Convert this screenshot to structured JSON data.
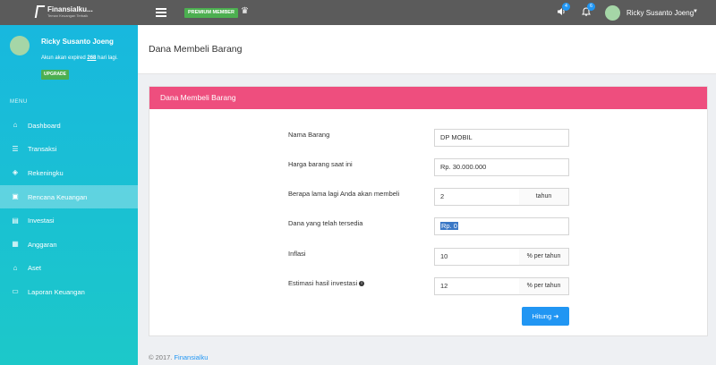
{
  "topbar": {
    "logo_text": "Finansialku...",
    "logo_sub": "Teman Keuangan Terbaik",
    "premium_label": "PREMIUM MEMBER",
    "sound_badge": "4",
    "bell_badge": "6",
    "user_name": "Ricky Susanto Joeng"
  },
  "sidebar": {
    "user_name": "Ricky Susanto Joeng",
    "expire_prefix": "Akun akan expired ",
    "expire_days": "268",
    "expire_suffix": " hari lagi.",
    "upgrade_label": "UPGRADE",
    "menu_heading": "MENU",
    "items": [
      {
        "label": "Dashboard",
        "icon": "home-icon"
      },
      {
        "label": "Transaksi",
        "icon": "list-icon"
      },
      {
        "label": "Rekeningku",
        "icon": "layers-icon"
      },
      {
        "label": "Rencana Keuangan",
        "icon": "clipboard-icon"
      },
      {
        "label": "Investasi",
        "icon": "chart-icon"
      },
      {
        "label": "Anggaran",
        "icon": "table-icon"
      },
      {
        "label": "Aset",
        "icon": "building-icon"
      },
      {
        "label": "Laporan Keuangan",
        "icon": "folder-icon"
      }
    ],
    "active_index": 3
  },
  "main": {
    "page_title": "Dana Membeli Barang",
    "card_title": "Dana Membeli Barang",
    "fields": {
      "nama_barang": {
        "label": "Nama Barang",
        "value": "DP MOBIL"
      },
      "harga": {
        "label": "Harga barang saat ini",
        "value": "Rp. 30.000.000"
      },
      "lama": {
        "label": "Berapa lama lagi Anda akan membeli",
        "value": "2",
        "suffix": "tahun"
      },
      "dana": {
        "label": "Dana yang telah tersedia",
        "value": "Rp. 0"
      },
      "inflasi": {
        "label": "Inflasi",
        "value": "10",
        "suffix": "% per tahun"
      },
      "investasi": {
        "label": "Estimasi hasil investasi",
        "value": "12",
        "suffix": "% per tahun"
      }
    },
    "button_label": "Hitung"
  },
  "footer": {
    "copyright": "© 2017. ",
    "link": "Finansialku"
  },
  "colors": {
    "topbar": "#5b5b5b",
    "sidebar_top": "#18b8de",
    "sidebar_bottom": "#1cc8c9",
    "card_header": "#ee4e7e",
    "button": "#2196f3",
    "premium": "#4caf50"
  }
}
